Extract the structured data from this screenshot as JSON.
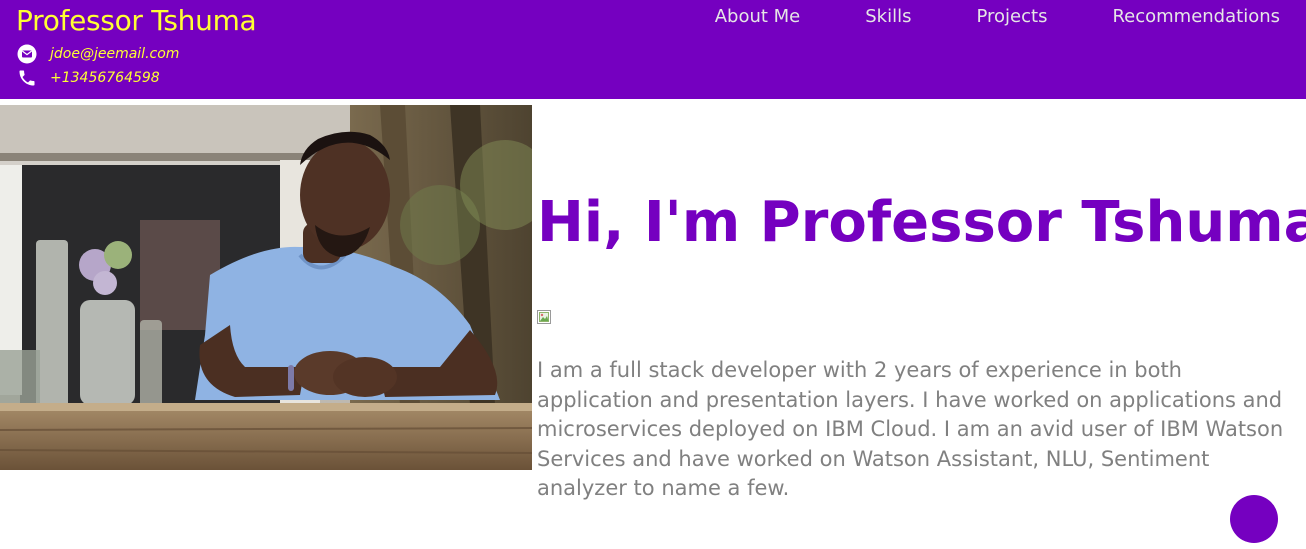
{
  "header": {
    "brand_name": "Professor Tshuma",
    "email": "jdoe@jeemail.com",
    "phone": "+13456764598",
    "email_icon": "envelope-icon",
    "phone_icon": "phone-icon"
  },
  "nav": {
    "items": [
      {
        "label": "About Me"
      },
      {
        "label": "Skills"
      },
      {
        "label": "Projects"
      },
      {
        "label": "Recommendations"
      }
    ]
  },
  "hero": {
    "title": "Hi, I'm Professor Tshuma!",
    "bio": "I am a full stack developer with 2 years of experience in both application and presentation layers. I have worked on applications and microservices deployed on IBM Cloud. I am an avid user of IBM Watson Services and have worked on Watson Assistant, NLU, Sentiment analyzer to name a few."
  },
  "colors": {
    "header_bg": "#7500c0",
    "brand": "#ffff33",
    "nav_text": "#e6e6e6",
    "title": "#7500c0",
    "body_text": "#808080",
    "fab": "#7500c0"
  }
}
